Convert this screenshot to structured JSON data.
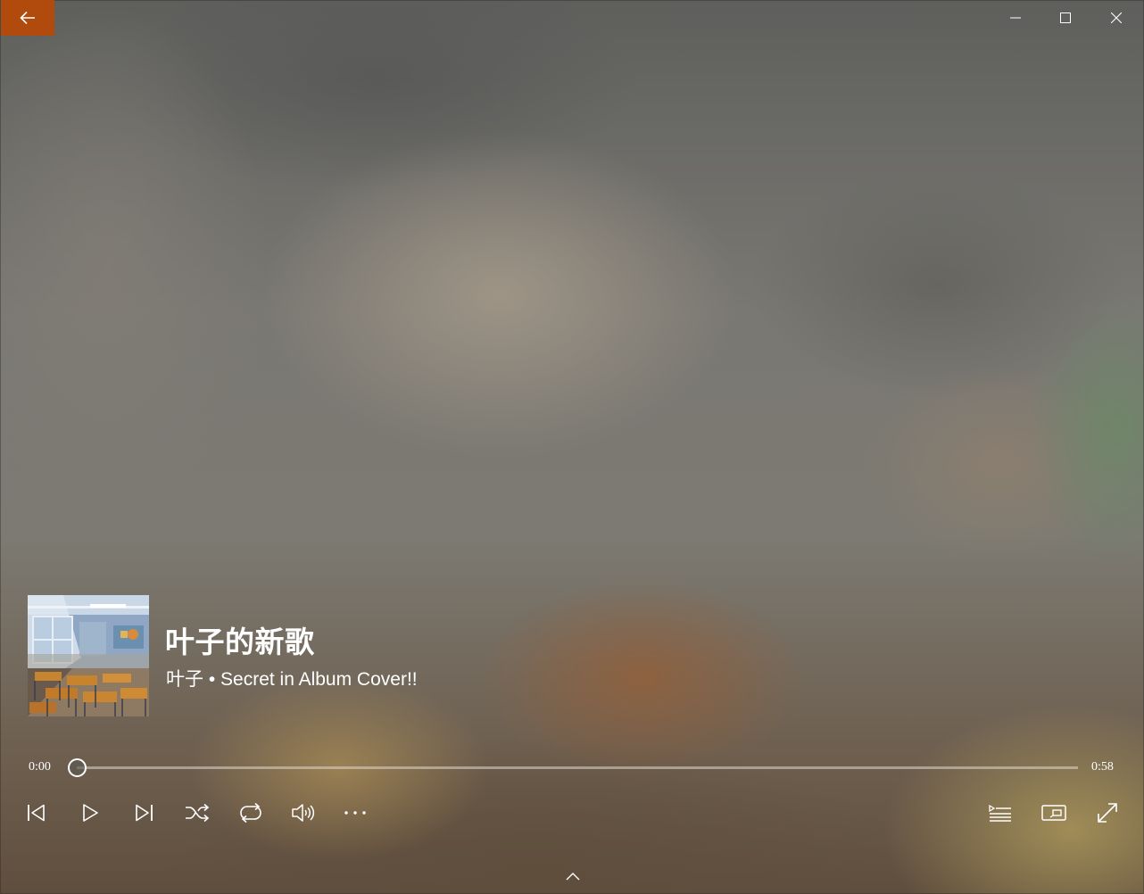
{
  "window": {
    "back_icon": "arrow-left-icon",
    "accent_color": "#b14a0d",
    "caption_icons": [
      "minimize-icon",
      "maximize-icon",
      "close-icon"
    ]
  },
  "now_playing": {
    "title": "叶子的新歌",
    "subtitle": "叶子 • Secret in Album Cover!!",
    "album_art": "classroom-artwork"
  },
  "progress": {
    "current_time": "0:00",
    "total_time": "0:58",
    "fraction": 0.0
  },
  "controls": {
    "left": [
      "previous-icon",
      "play-icon",
      "next-icon",
      "shuffle-icon",
      "repeat-icon",
      "volume-icon",
      "more-icon"
    ],
    "right": [
      "now-playing-list-icon",
      "mini-view-icon",
      "full-screen-icon"
    ],
    "bottom": "chevron-up-icon"
  }
}
